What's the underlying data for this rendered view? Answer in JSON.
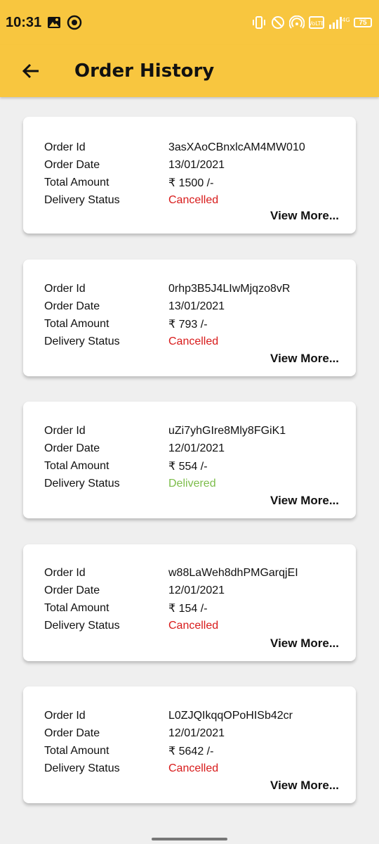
{
  "statusbar": {
    "time": "10:31",
    "battery": "75",
    "network": "4G"
  },
  "header": {
    "title": "Order History"
  },
  "orders": [
    {
      "labels": {
        "id": "Order Id",
        "date": "Order Date",
        "amount": "Total Amount",
        "status": "Delivery Status"
      },
      "id": "3asXAoCBnxlcAM4MW010",
      "date": "13/01/2021",
      "amount": "₹ 1500 /-",
      "status": "Cancelled",
      "view_more": "View More..."
    },
    {
      "labels": {
        "id": "Order Id",
        "date": "Order Date",
        "amount": "Total Amount",
        "status": "Delivery Status"
      },
      "id": "0rhp3B5J4LIwMjqzo8vR",
      "date": "13/01/2021",
      "amount": "₹ 793 /-",
      "status": "Cancelled",
      "view_more": "View More..."
    },
    {
      "labels": {
        "id": "Order Id",
        "date": "Order Date",
        "amount": "Total Amount",
        "status": "Delivery Status"
      },
      "id": "uZi7yhGIre8Mly8FGiK1",
      "date": "12/01/2021",
      "amount": "₹ 554 /-",
      "status": "Delivered",
      "view_more": "View More..."
    },
    {
      "labels": {
        "id": "Order Id",
        "date": "Order Date",
        "amount": "Total Amount",
        "status": "Delivery Status"
      },
      "id": "w88LaWeh8dhPMGarqjEI",
      "date": "12/01/2021",
      "amount": "₹ 154 /-",
      "status": "Cancelled",
      "view_more": "View More..."
    },
    {
      "labels": {
        "id": "Order Id",
        "date": "Order Date",
        "amount": "Total Amount",
        "status": "Delivery Status"
      },
      "id": "L0ZJQIkqqOPoHISb42cr",
      "date": "12/01/2021",
      "amount": "₹ 5642 /-",
      "status": "Cancelled",
      "view_more": "View More..."
    }
  ],
  "colors": {
    "accent": "#f8c63f",
    "cancelled": "#d81b1b",
    "delivered": "#7cbd4a"
  },
  "icons": {
    "back": "arrow-left-icon",
    "gallery": "image-icon",
    "app": "circle-app-icon",
    "vibrate": "vibrate-icon",
    "dnd": "do-not-disturb-icon",
    "hotspot": "hotspot-icon",
    "volte": "volte-icon",
    "signal": "signal-icon",
    "battery": "battery-icon"
  }
}
